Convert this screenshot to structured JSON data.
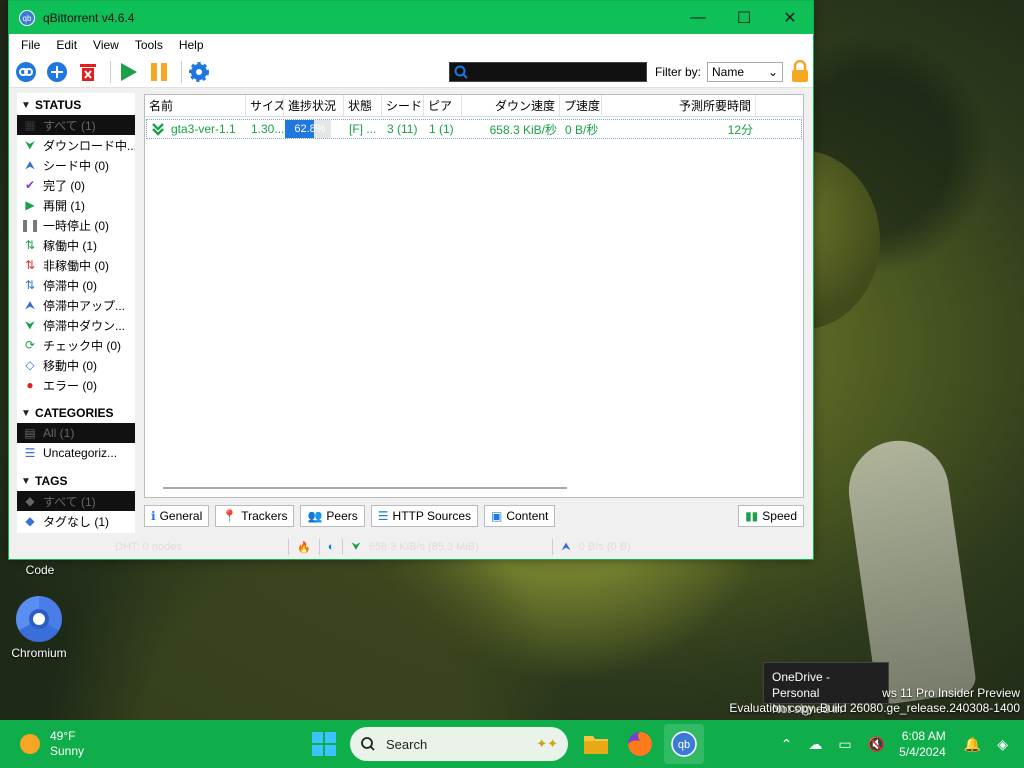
{
  "window": {
    "title": "qBittorrent v4.6.4",
    "icon_text": "qb",
    "minimize": "—",
    "maximize": "☐",
    "close": "✕"
  },
  "menu": [
    "File",
    "Edit",
    "View",
    "Tools",
    "Help"
  ],
  "toolbar": {
    "filter_label": "Filter by:",
    "filter_value": "Name"
  },
  "sidebar": {
    "status_header": "STATUS",
    "status_items": [
      {
        "label": "すべて (1)",
        "icon": "all-icon",
        "color": "#333"
      },
      {
        "label": "ダウンロード中...",
        "icon": "download-icon",
        "color": "#1aa04a"
      },
      {
        "label": "シード中 (0)",
        "icon": "upload-icon",
        "color": "#3a6fd8"
      },
      {
        "label": "完了 (0)",
        "icon": "check-icon",
        "color": "#7a3fd0"
      },
      {
        "label": "再開 (1)",
        "icon": "play-icon",
        "color": "#1aa04a"
      },
      {
        "label": "一時停止 (0)",
        "icon": "pause-icon",
        "color": "#777"
      },
      {
        "label": "稼働中 (1)",
        "icon": "active-icon",
        "color": "#1aa04a"
      },
      {
        "label": "非稼働中 (0)",
        "icon": "inactive-icon",
        "color": "#e03030"
      },
      {
        "label": "停滞中 (0)",
        "icon": "stalled-icon",
        "color": "#3a6fd8"
      },
      {
        "label": "停滞中アップ...",
        "icon": "stalled-up-icon",
        "color": "#3a6fd8"
      },
      {
        "label": "停滞中ダウン...",
        "icon": "stalled-down-icon",
        "color": "#1aa04a"
      },
      {
        "label": "チェック中 (0)",
        "icon": "checking-icon",
        "color": "#1aa04a"
      },
      {
        "label": "移動中 (0)",
        "icon": "moving-icon",
        "color": "#3a6fd8"
      },
      {
        "label": "エラー (0)",
        "icon": "error-icon",
        "color": "#e02020"
      }
    ],
    "categories_header": "CATEGORIES",
    "category_items": [
      {
        "label": "All (1)",
        "selected": true
      },
      {
        "label": "Uncategoriz..."
      }
    ],
    "tags_header": "TAGS",
    "tag_items": [
      {
        "label": "すべて (1)",
        "selected": true
      },
      {
        "label": "タグなし (1)"
      }
    ]
  },
  "table": {
    "headers": [
      "名前",
      "サイズ",
      "進捗状況",
      "状態",
      "シード",
      "ピア",
      "ダウン速度",
      "プ速度",
      "予測所要時間"
    ],
    "rows": [
      {
        "name": "gta3-ver-1.1",
        "size": "1.30...",
        "progress_text": "62.8%",
        "progress": 0.628,
        "state": "[F] ...",
        "seeds": "3 (11)",
        "peers": "1 (1)",
        "down_speed": "658.3 KiB/秒",
        "up_speed": "0 B/秒",
        "eta": "12分"
      }
    ]
  },
  "tabs": [
    "General",
    "Trackers",
    "Peers",
    "HTTP Sources",
    "Content"
  ],
  "speed_button": "Speed",
  "statusbar": {
    "dht": "DHT: 0 nodes",
    "down": "658.3 KiB/s (85.3 MiB)",
    "up": "0 B/s (0 B)"
  },
  "desktop": {
    "code_label": "Code",
    "chromium_label": "Chromium",
    "tooltip_line1": "OneDrive - Personal",
    "tooltip_line2": "Not signed in",
    "watermark_line1": "ws 11 Pro Insider Preview",
    "watermark_line2": "Evaluation copy. Build 26080.ge_release.240308-1400"
  },
  "taskbar": {
    "temp": "49°F",
    "condition": "Sunny",
    "search": "Search",
    "time": "6:08 AM",
    "date": "5/4/2024"
  },
  "colors": {
    "titlebar": "#0fbf58",
    "taskbar": "#0fae4a",
    "progress_fill": "#1e78e0",
    "row_text": "#1aa04a"
  }
}
